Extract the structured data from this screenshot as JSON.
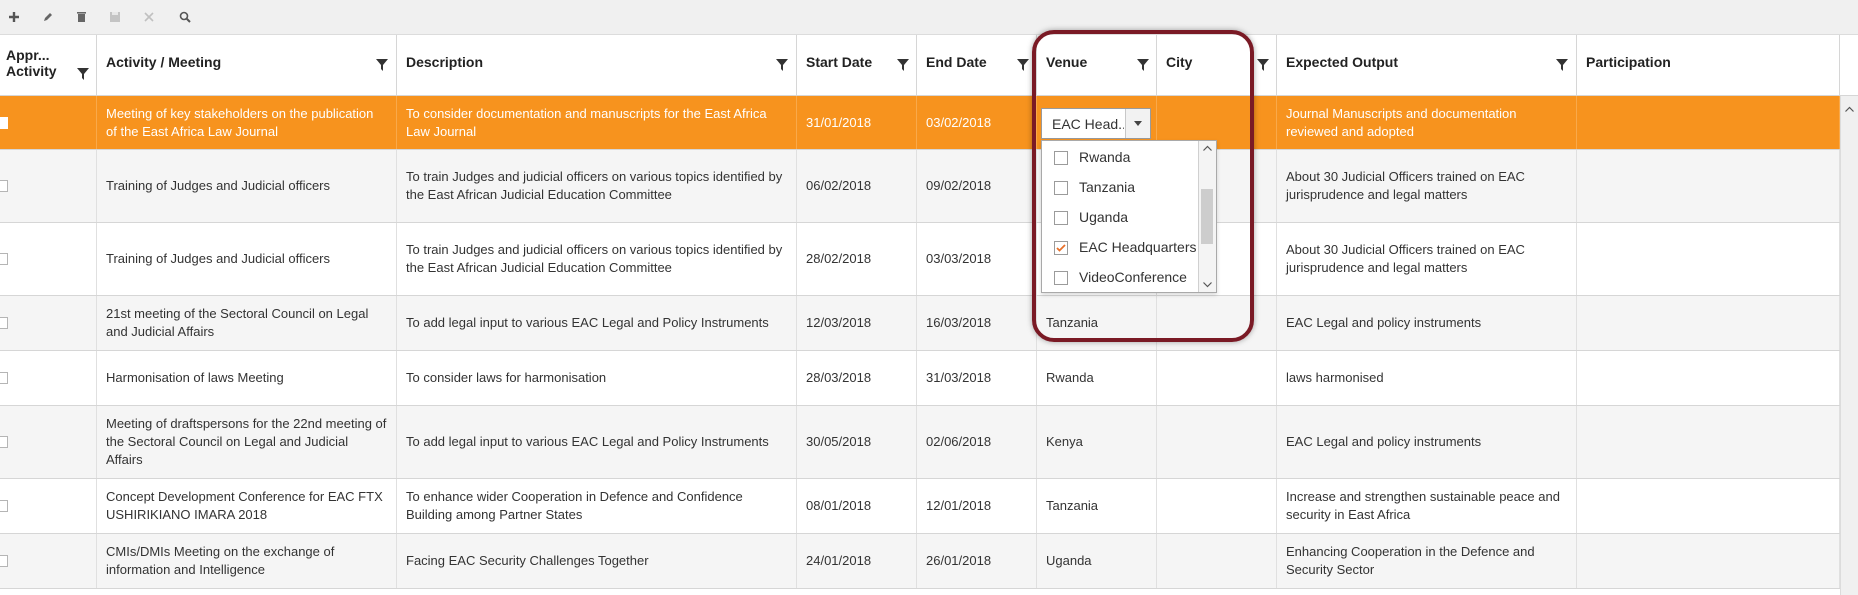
{
  "toolbar": {
    "buttons": [
      {
        "name": "add-icon",
        "icon": "plus"
      },
      {
        "name": "edit-icon",
        "icon": "pencil"
      },
      {
        "name": "delete-icon",
        "icon": "trash"
      },
      {
        "name": "save-icon",
        "icon": "floppy"
      },
      {
        "name": "cancel-icon",
        "icon": "x"
      },
      {
        "name": "search-icon",
        "icon": "magnifier"
      }
    ]
  },
  "columns": {
    "approve": "Appr... Activity",
    "approve_line1": "Appr...",
    "approve_line2": "Activity",
    "activity": "Activity / Meeting",
    "description": "Description",
    "start": "Start Date",
    "end": "End Date",
    "venue": "Venue",
    "city": "City",
    "output": "Expected Output",
    "participation": "Participation"
  },
  "rows": [
    {
      "activity": "Meeting of key stakeholders on the publication of the East Africa Law Journal",
      "description": "To consider documentation and manuscripts for the East Africa Law Journal",
      "start": "31/01/2018",
      "end": "03/02/2018",
      "venue": "",
      "city": "",
      "output": "Journal Manuscripts and documentation reviewed and adopted",
      "participation": ""
    },
    {
      "activity": "Training of Judges and Judicial officers",
      "description": "To train Judges and judicial officers on various topics identified by the East African Judicial Education Committee",
      "start": "06/02/2018",
      "end": "09/02/2018",
      "venue": "",
      "city": "",
      "output": "About 30 Judicial Officers trained on EAC jurisprudence and legal matters",
      "participation": ""
    },
    {
      "activity": "Training of Judges and Judicial officers",
      "description": "To train Judges and judicial officers on various topics identified by the East African Judicial Education Committee",
      "start": "28/02/2018",
      "end": "03/03/2018",
      "venue": "",
      "city": "",
      "output": "About 30 Judicial Officers trained on EAC jurisprudence and legal matters",
      "participation": ""
    },
    {
      "activity": "21st meeting of the Sectoral Council on Legal and Judicial Affairs",
      "description": "To add legal input to various EAC Legal and Policy Instruments",
      "start": "12/03/2018",
      "end": "16/03/2018",
      "venue": "Tanzania",
      "city": "",
      "output": "EAC Legal and policy instruments",
      "participation": ""
    },
    {
      "activity": "Harmonisation of laws Meeting",
      "description": "To consider laws for harmonisation",
      "start": "28/03/2018",
      "end": "31/03/2018",
      "venue": "Rwanda",
      "city": "",
      "output": "laws harmonised",
      "participation": ""
    },
    {
      "activity": "Meeting of draftspersons for the 22nd meeting of the Sectoral Council on Legal and Judicial Affairs",
      "description": "To add legal input to various EAC Legal and Policy Instruments",
      "start": "30/05/2018",
      "end": "02/06/2018",
      "venue": "Kenya",
      "city": "",
      "output": "EAC Legal and policy instruments",
      "participation": ""
    },
    {
      "activity": "Concept Development Conference for EAC FTX USHIRIKIANO IMARA 2018",
      "description": "To enhance wider Cooperation in Defence and Confidence Building among Partner States",
      "start": "08/01/2018",
      "end": "12/01/2018",
      "venue": "Tanzania",
      "city": "",
      "output": "Increase and strengthen sustainable peace and security in East Africa",
      "participation": ""
    },
    {
      "activity": "CMIs/DMIs Meeting on the exchange of information and Intelligence",
      "description": "Facing EAC Security Challenges Together",
      "start": "24/01/2018",
      "end": "26/01/2018",
      "venue": "Uganda",
      "city": "",
      "output": "Enhancing Cooperation in the Defence and Security Sector",
      "participation": ""
    }
  ],
  "venue_editor": {
    "value": "EAC Head...",
    "options": [
      {
        "label": "Rwanda",
        "checked": false
      },
      {
        "label": "Tanzania",
        "checked": false
      },
      {
        "label": "Uganda",
        "checked": false
      },
      {
        "label": "EAC Headquarters",
        "checked": true
      },
      {
        "label": "VideoConference",
        "checked": false
      }
    ]
  },
  "colors": {
    "selected_row": "#f7931e",
    "highlight_border": "#7a1a25",
    "check_mark": "#e8702a"
  }
}
